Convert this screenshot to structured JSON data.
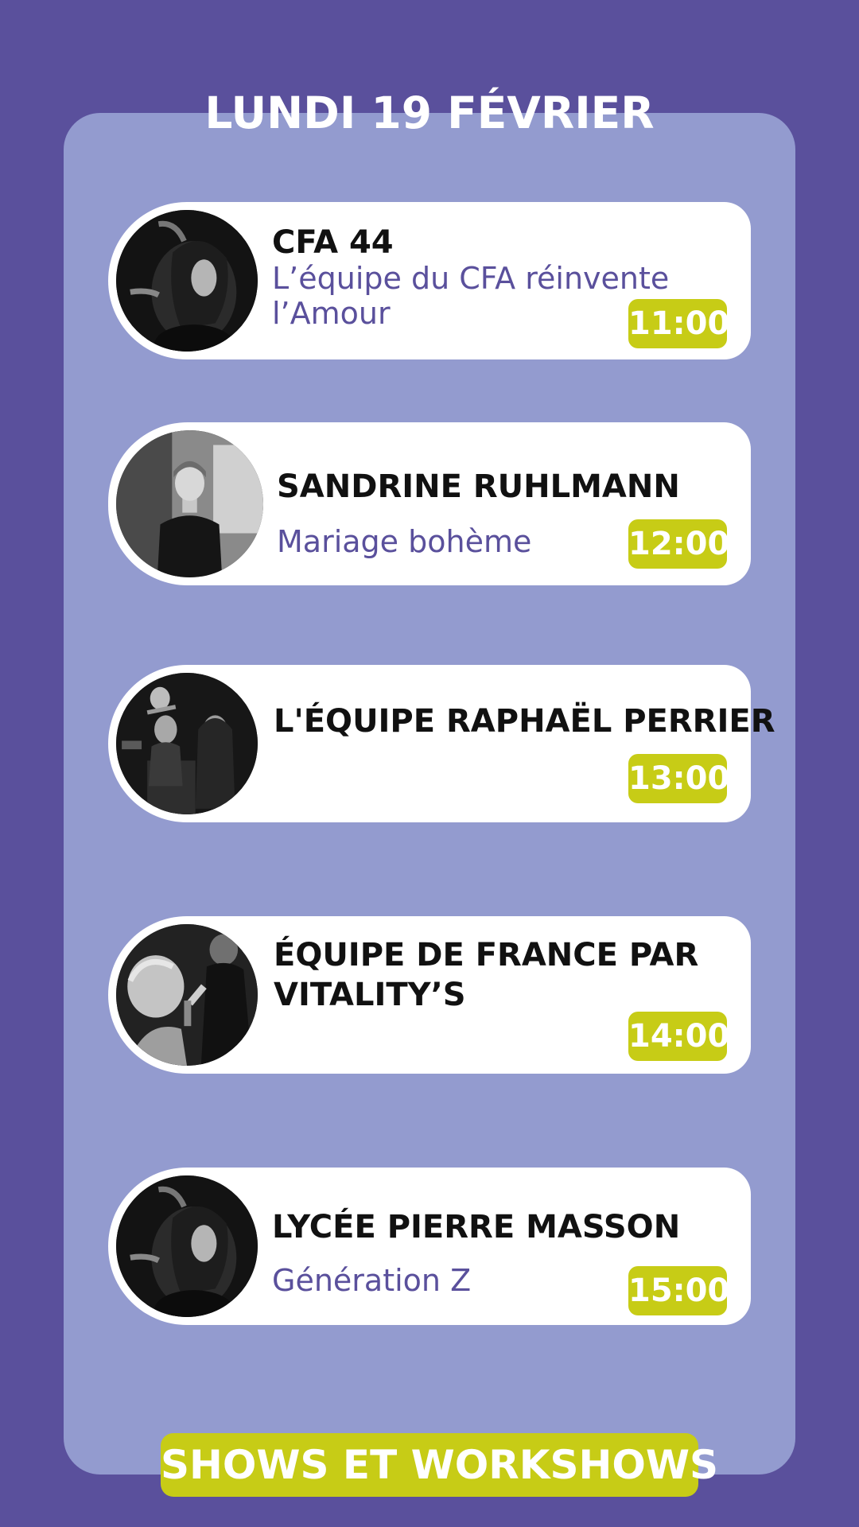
{
  "header": {
    "title": "LUNDI 19 FÉVRIER"
  },
  "events": [
    {
      "title": "CFA 44",
      "subtitle": "L’équipe du CFA réinvente l’Amour",
      "subtitle_line1": "L’équipe du CFA réinvente",
      "subtitle_line2": "l’Amour",
      "time": "11:00",
      "image": "hairdresser-styling-photo"
    },
    {
      "title": "SANDRINE RUHLMANN",
      "subtitle": "Mariage bohème",
      "time": "12:00",
      "image": "portrait-photo"
    },
    {
      "title": "L'ÉQUIPE RAPHAËL PERRIER",
      "time": "13:00",
      "image": "salon-team-photo"
    },
    {
      "title": "ÉQUIPE DE FRANCE PAR VITALITY’S",
      "title_line1": "ÉQUIPE DE FRANCE PAR",
      "title_line2": "VITALITY’S",
      "time": "14:00",
      "image": "updo-styling-photo"
    },
    {
      "title": "LYCÉE PIERRE MASSON",
      "subtitle": "Génération Z",
      "time": "15:00",
      "image": "hairdresser-styling-photo"
    }
  ],
  "footer": {
    "banner": "SHOWS ET WORKSHOWS"
  },
  "colors": {
    "background": "#5a509c",
    "panel": "#939bcf",
    "accent": "#c7cc16",
    "subtitle": "#5a509c"
  }
}
